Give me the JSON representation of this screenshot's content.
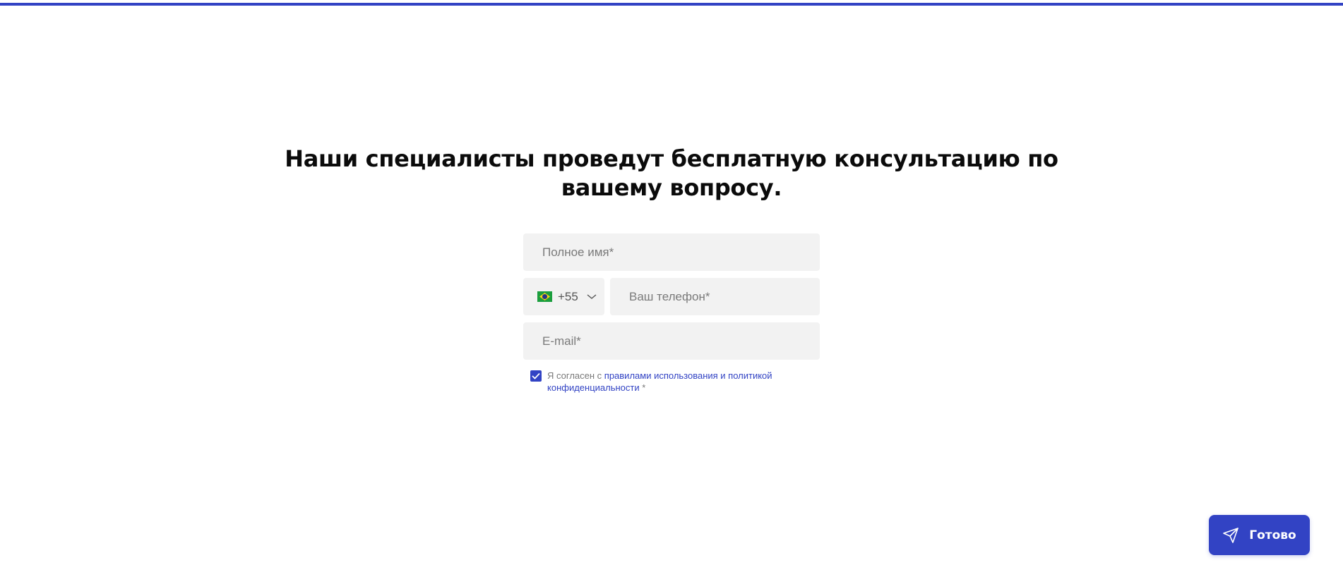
{
  "progress": {
    "fraction": 1.0,
    "color": "#3243c4"
  },
  "heading": "Наши специалисты проведут бесплатную консультацию по вашему вопросу.",
  "form": {
    "name_placeholder": "Полное имя*",
    "country": {
      "flag_icon": "brazil-flag-icon",
      "dial_code": "+55"
    },
    "phone_placeholder": "Ваш телефон*",
    "email_placeholder": "E-mail*",
    "consent": {
      "checked": true,
      "prefix": "Я согласен с ",
      "link": "правилами использования и политикой конфиденциальности",
      "suffix": " *"
    }
  },
  "submit_label": "Готово",
  "colors": {
    "accent": "#3243c4",
    "field_bg": "#f2f2f2"
  }
}
